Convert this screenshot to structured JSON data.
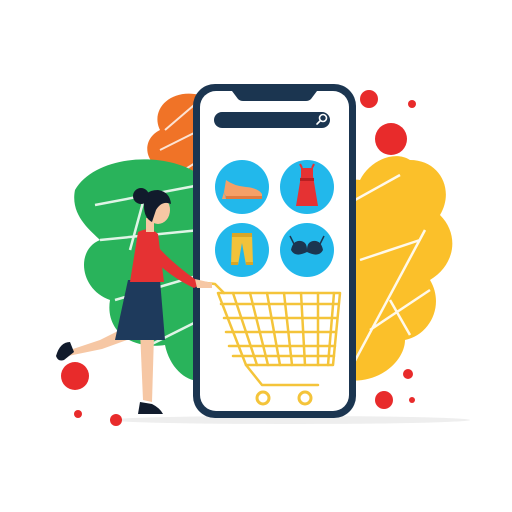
{
  "illustration": {
    "subject": "online-shopping",
    "phone": {
      "search_bar": {
        "placeholder": "",
        "icon": "search-icon"
      },
      "categories": [
        {
          "icon": "shoe-icon"
        },
        {
          "icon": "dress-icon"
        },
        {
          "icon": "pants-icon"
        },
        {
          "icon": "bra-icon"
        }
      ]
    },
    "figures": [
      "woman-shopper",
      "shopping-cart"
    ]
  },
  "colors": {
    "phone_frame": "#1b3550",
    "screen": "#ffffff",
    "search_bar": "#1b3550",
    "category_circle": "#22b8eb",
    "leaf_green": "#29b35b",
    "leaf_orange": "#f07327",
    "leaf_yellow": "#fbc02a",
    "dots_red": "#e82b2b",
    "cart_yellow": "#f4c43a",
    "shirt_red": "#e53233",
    "skirt_navy": "#1e3a5c",
    "skin": "#f6c7a4",
    "hair": "#111b2c"
  }
}
